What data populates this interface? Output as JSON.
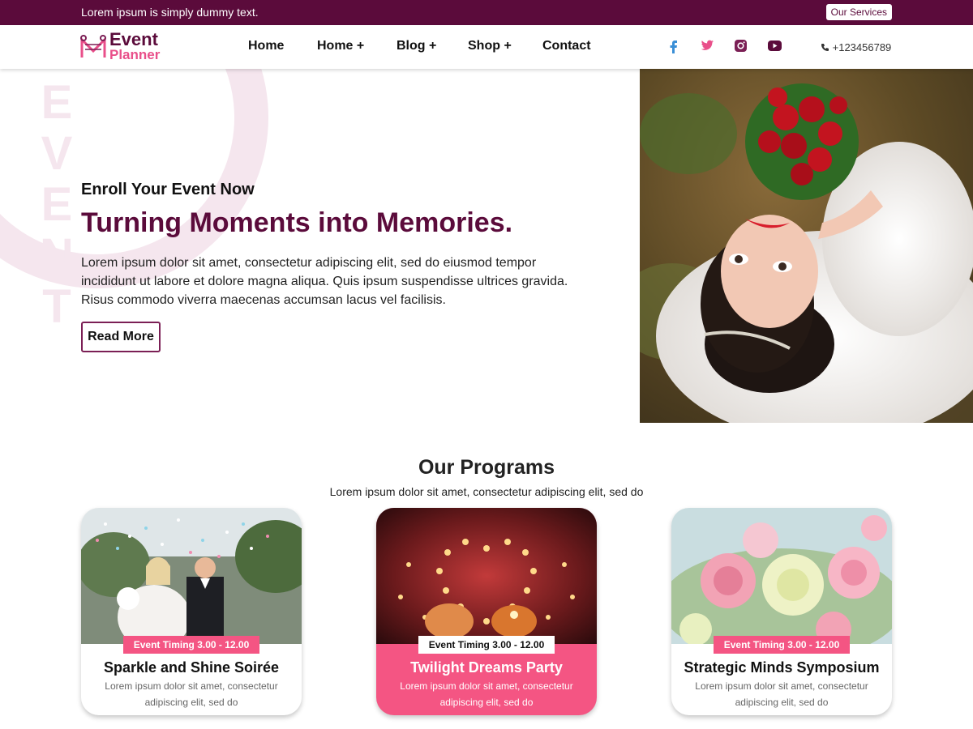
{
  "topbar": {
    "message": "Lorem ipsum is simply dummy text.",
    "services_label": "Our Services"
  },
  "logo": {
    "line1": "Event",
    "line2": "Planner"
  },
  "nav": {
    "items": [
      "Home",
      "Home +",
      "Blog +",
      "Shop +",
      "Contact"
    ]
  },
  "social": {
    "icons": [
      "facebook-icon",
      "twitter-icon",
      "instagram-icon",
      "youtube-icon"
    ],
    "colors": {
      "facebook": "#3b8fd6",
      "twitter": "#e94f8a",
      "instagram": "#7b1f55",
      "youtube": "#5b0b3b"
    }
  },
  "contact": {
    "phone": "+123456789"
  },
  "hero": {
    "watermark": [
      "E",
      "V",
      "E",
      "N",
      "T"
    ],
    "eyebrow": "Enroll Your Event Now",
    "title": "Turning Moments into Memories.",
    "text": "Lorem ipsum dolor sit amet, consectetur adipiscing elit, sed do eiusmod tempor incididunt ut labore et dolore magna aliqua. Quis ipsum suspendisse ultrices gravida. Risus commodo viverra maecenas accumsan lacus vel facilisis.",
    "button": "Read More"
  },
  "programs": {
    "title": "Our Programs",
    "subtitle": "Lorem ipsum dolor sit amet, consectetur adipiscing elit, sed do",
    "cards": [
      {
        "badge": "Event  Timing 3.00 - 12.00",
        "title": "Sparkle and Shine Soirée",
        "text": "Lorem ipsum dolor sit amet, consectetur adipiscing elit, sed do"
      },
      {
        "badge": "Event  Timing 3.00 - 12.00",
        "title": "Twilight Dreams Party",
        "text": "Lorem ipsum dolor sit amet, consectetur adipiscing elit, sed do"
      },
      {
        "badge": "Event  Timing 3.00 - 12.00",
        "title": "Strategic Minds Symposium",
        "text": "Lorem ipsum dolor sit amet, consectetur adipiscing elit, sed do"
      }
    ]
  },
  "colors": {
    "brand": "#5b0b3b",
    "accent": "#f45583",
    "pink": "#e94f8a"
  }
}
